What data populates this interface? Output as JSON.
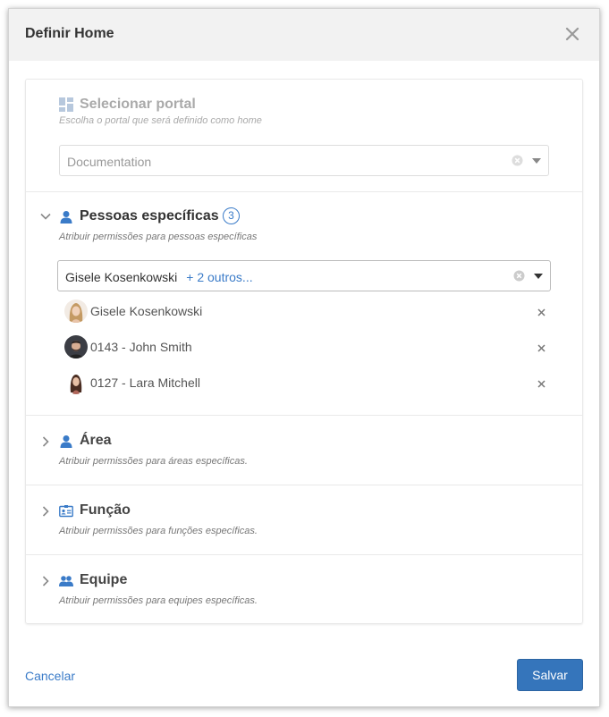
{
  "dialog": {
    "title": "Definir Home",
    "close_icon": "close-icon"
  },
  "portal": {
    "title": "Selecionar portal",
    "subtitle": "Escolha o portal que será definido como home",
    "select_value": "Documentation",
    "icon": "dashboard-icon"
  },
  "pessoas": {
    "title": "Pessoas específicas",
    "count": "3",
    "subtitle": "Atribuir permissões para pessoas específicas",
    "select_value": "Gisele Kosenkowski",
    "select_more": "+ 2 outros...",
    "icon": "person-icon",
    "users": [
      {
        "name": "Gisele Kosenkowski"
      },
      {
        "name": "0143 - John Smith"
      },
      {
        "name": "0127 - Lara Mitchell"
      }
    ]
  },
  "area": {
    "title": "Área",
    "subtitle": "Atribuir permissões para áreas específicas.",
    "icon": "person-icon"
  },
  "funcao": {
    "title": "Função",
    "subtitle": "Atribuir permissões para funções específicas.",
    "icon": "id-card-icon"
  },
  "equipe": {
    "title": "Equipe",
    "subtitle": "Atribuir permissões para equipes específicas.",
    "icon": "team-icon"
  },
  "footer": {
    "cancel_label": "Cancelar",
    "save_label": "Salvar"
  },
  "colors": {
    "accent": "#3575bb",
    "link": "#3a7bc8",
    "header_bg": "#f2f2f2"
  }
}
